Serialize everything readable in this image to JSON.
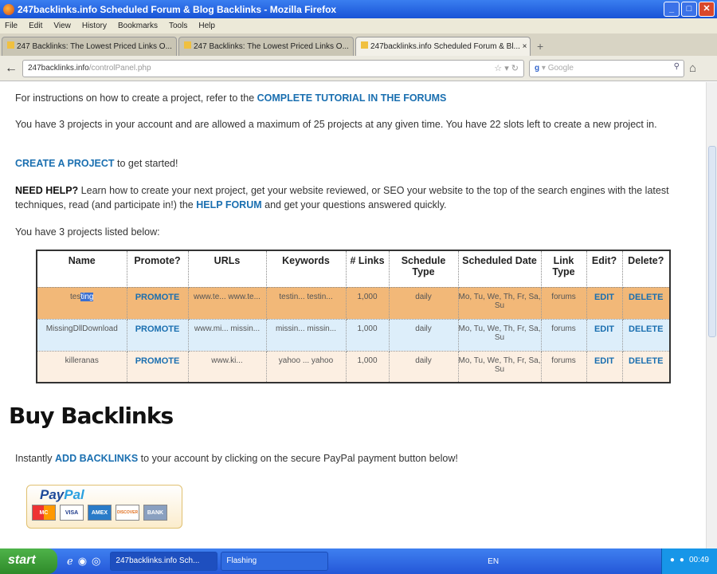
{
  "window": {
    "title": "247backlinks.info Scheduled Forum & Blog Backlinks - Mozilla Firefox"
  },
  "menu": [
    "File",
    "Edit",
    "View",
    "History",
    "Bookmarks",
    "Tools",
    "Help"
  ],
  "tabs": [
    {
      "label": "247 Backlinks: The Lowest Priced Links O..."
    },
    {
      "label": "247 Backlinks: The Lowest Priced Links O..."
    },
    {
      "label": "247backlinks.info Scheduled Forum & Bl..."
    }
  ],
  "nav": {
    "url_domain": "247backlinks.info",
    "url_path": "/controlPanel.php",
    "search_placeholder": "Google"
  },
  "content": {
    "instructions_text": "For instructions on how to create a project, refer to the ",
    "tutorial_link": "COMPLETE TUTORIAL IN THE FORUMS",
    "projects_text": "You have 3 projects in your account and are allowed a maximum of 25 projects at any given time. You have 22 slots left to create a new project in.",
    "create_link": "CREATE A PROJECT",
    "create_suffix": " to get started!",
    "help_label": "NEED HELP?",
    "help_text": " Learn how to create your next project, get your website reviewed, or SEO your website to the top of the search engines with the latest techniques, read (and participate in!) the ",
    "help_forum_link": "HELP FORUM",
    "help_suffix": " and get your questions answered quickly.",
    "listed_text": "You have 3 projects listed below:",
    "table": {
      "headers": [
        "Name",
        "Promote?",
        "URLs",
        "Keywords",
        "# Links",
        "Schedule Type",
        "Scheduled Date",
        "Link Type",
        "Edit?",
        "Delete?"
      ],
      "rows": [
        {
          "name_a": "tes",
          "name_b": "ting",
          "promote": "PROMOTE",
          "urls": "www.te... www.te...",
          "keywords": "testin... testin...",
          "links": "1,000",
          "schedule": "daily",
          "date": "Mo, Tu, We, Th, Fr, Sa, Su",
          "type": "forums",
          "edit": "EDIT",
          "delete": "DELETE"
        },
        {
          "name": "MissingDllDownload",
          "promote": "PROMOTE",
          "urls": "www.mi... missin...",
          "keywords": "missin... missin...",
          "links": "1,000",
          "schedule": "daily",
          "date": "Mo, Tu, We, Th, Fr, Sa, Su",
          "type": "forums",
          "edit": "EDIT",
          "delete": "DELETE"
        },
        {
          "name": "killeranas",
          "promote": "PROMOTE",
          "urls": "www.ki...",
          "keywords": "yahoo ... yahoo",
          "links": "1,000",
          "schedule": "daily",
          "date": "Mo, Tu, We, Th, Fr, Sa, Su",
          "type": "forums",
          "edit": "EDIT",
          "delete": "DELETE"
        }
      ]
    },
    "buy_heading": "Buy Backlinks",
    "buy_prefix": "Instantly ",
    "buy_link": "ADD BACKLINKS",
    "buy_suffix": " to your account by clicking on the secure PayPal payment button below!",
    "paypal": {
      "logo": "PayPal",
      "cards": [
        "MC",
        "VISA",
        "AMEX",
        "DISCOVER",
        "BANK"
      ]
    }
  },
  "taskbar": {
    "start": "start",
    "items": [
      "247backlinks.info Sch...",
      "Flashing"
    ],
    "lang": "EN",
    "clock": "00:49"
  }
}
